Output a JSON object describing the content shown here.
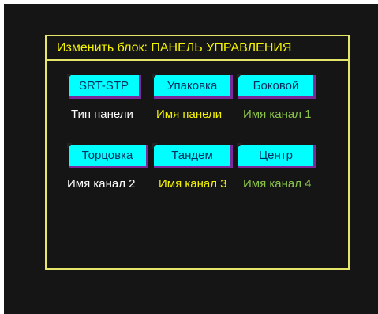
{
  "dialog": {
    "title": "Изменить блок:  ПАНЕЛЬ УПРАВЛЕНИЯ"
  },
  "buttons": [
    {
      "label": "SRT-STP"
    },
    {
      "label": "Упаковка"
    },
    {
      "label": "Боковой"
    },
    {
      "label": "Торцовка"
    },
    {
      "label": "Тандем"
    },
    {
      "label": "Центр"
    }
  ],
  "labels": [
    {
      "text": "Тип панели",
      "color": "#ffffff"
    },
    {
      "text": "Имя панели",
      "color": "#f4f400"
    },
    {
      "text": "Имя канал 1",
      "color": "#8bc34a"
    },
    {
      "text": "Имя канал 2",
      "color": "#ffffff"
    },
    {
      "text": "Имя канал 3",
      "color": "#f4f400"
    },
    {
      "text": "Имя канал 4",
      "color": "#8bc34a"
    }
  ],
  "colors": {
    "screen_bg": "#151515",
    "accent": "#f4f400",
    "button_bg": "#00ffff",
    "button_shadow": "#7a2a9a"
  }
}
